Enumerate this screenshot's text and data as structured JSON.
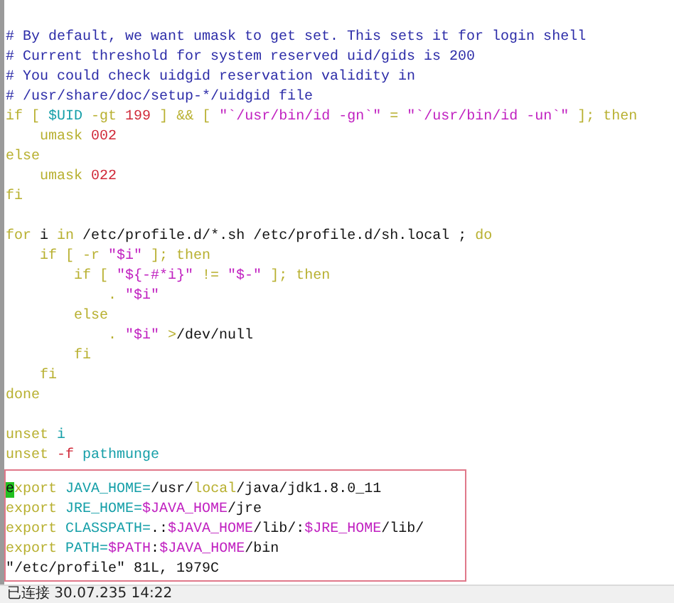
{
  "editor": {
    "lines": [
      {
        "kind": "blank"
      },
      {
        "kind": "code",
        "segments": [
          {
            "kind": "comment",
            "text": "# By default, we want umask to get set. This sets it for login shell"
          }
        ]
      },
      {
        "kind": "code",
        "segments": [
          {
            "kind": "comment",
            "text": "# Current threshold for system reserved uid/gids is 200"
          }
        ]
      },
      {
        "kind": "code",
        "segments": [
          {
            "kind": "comment",
            "text": "# You could check uidgid reservation validity in"
          }
        ]
      },
      {
        "kind": "code",
        "segments": [
          {
            "kind": "comment",
            "text": "# /usr/share/doc/setup-*/uidgid file"
          }
        ]
      },
      {
        "kind": "code",
        "segments": [
          {
            "kind": "kw",
            "text": "if [ "
          },
          {
            "kind": "var",
            "text": "$UID"
          },
          {
            "kind": "kw",
            "text": " -gt "
          },
          {
            "kind": "num",
            "text": "199"
          },
          {
            "kind": "kw",
            "text": " ] && [ "
          },
          {
            "kind": "str",
            "text": "\"`/usr/bin/id -gn`\""
          },
          {
            "kind": "kw",
            "text": " = "
          },
          {
            "kind": "str",
            "text": "\"`/usr/bin/id -un`\""
          },
          {
            "kind": "kw",
            "text": " ]; then"
          }
        ]
      },
      {
        "kind": "code",
        "segments": [
          {
            "kind": "kw",
            "text": "    umask "
          },
          {
            "kind": "num",
            "text": "002"
          }
        ]
      },
      {
        "kind": "code",
        "segments": [
          {
            "kind": "kw",
            "text": "else"
          }
        ]
      },
      {
        "kind": "code",
        "segments": [
          {
            "kind": "kw",
            "text": "    umask "
          },
          {
            "kind": "num",
            "text": "022"
          }
        ]
      },
      {
        "kind": "code",
        "segments": [
          {
            "kind": "kw",
            "text": "fi"
          }
        ]
      },
      {
        "kind": "blank"
      },
      {
        "kind": "code",
        "segments": [
          {
            "kind": "kw",
            "text": "for"
          },
          {
            "kind": "plain",
            "text": " i "
          },
          {
            "kind": "kw",
            "text": "in"
          },
          {
            "kind": "plain",
            "text": " /etc/profile.d/*.sh /etc/profile.d/sh.local ; "
          },
          {
            "kind": "kw",
            "text": "do"
          }
        ]
      },
      {
        "kind": "code",
        "segments": [
          {
            "kind": "kw",
            "text": "    if [ -r "
          },
          {
            "kind": "str",
            "text": "\"$i\""
          },
          {
            "kind": "kw",
            "text": " ]; then"
          }
        ]
      },
      {
        "kind": "code",
        "segments": [
          {
            "kind": "kw",
            "text": "        if [ "
          },
          {
            "kind": "str",
            "text": "\"${-#*i}\""
          },
          {
            "kind": "kw",
            "text": " != "
          },
          {
            "kind": "str",
            "text": "\"$-\""
          },
          {
            "kind": "kw",
            "text": " ]; then"
          }
        ]
      },
      {
        "kind": "code",
        "segments": [
          {
            "kind": "kw",
            "text": "            . "
          },
          {
            "kind": "str",
            "text": "\"$i\""
          }
        ]
      },
      {
        "kind": "code",
        "segments": [
          {
            "kind": "kw",
            "text": "        else"
          }
        ]
      },
      {
        "kind": "code",
        "segments": [
          {
            "kind": "kw",
            "text": "            . "
          },
          {
            "kind": "str",
            "text": "\"$i\""
          },
          {
            "kind": "kw",
            "text": " >"
          },
          {
            "kind": "plain",
            "text": "/dev/null"
          }
        ]
      },
      {
        "kind": "code",
        "segments": [
          {
            "kind": "kw",
            "text": "        fi"
          }
        ]
      },
      {
        "kind": "code",
        "segments": [
          {
            "kind": "kw",
            "text": "    fi"
          }
        ]
      },
      {
        "kind": "code",
        "segments": [
          {
            "kind": "kw",
            "text": "done"
          }
        ]
      },
      {
        "kind": "blank"
      },
      {
        "kind": "code",
        "segments": [
          {
            "kind": "kw",
            "text": "unset "
          },
          {
            "kind": "var",
            "text": "i"
          }
        ]
      },
      {
        "kind": "code",
        "segments": [
          {
            "kind": "kw",
            "text": "unset "
          },
          {
            "kind": "num",
            "text": "-f "
          },
          {
            "kind": "var",
            "text": "pathmunge"
          }
        ]
      }
    ],
    "boxed_lines": [
      {
        "kind": "code",
        "segments": [
          {
            "kind": "cursor",
            "text": "e"
          },
          {
            "kind": "kw",
            "text": "xport "
          },
          {
            "kind": "var",
            "text": "JAVA_HOME="
          },
          {
            "kind": "plain",
            "text": "/usr/"
          },
          {
            "kind": "kw",
            "text": "local"
          },
          {
            "kind": "plain",
            "text": "/java/jdk1.8.0_11"
          }
        ]
      },
      {
        "kind": "code",
        "segments": [
          {
            "kind": "kw",
            "text": "export "
          },
          {
            "kind": "var",
            "text": "JRE_HOME="
          },
          {
            "kind": "str",
            "text": "$JAVA_HOME"
          },
          {
            "kind": "plain",
            "text": "/jre"
          }
        ]
      },
      {
        "kind": "code",
        "segments": [
          {
            "kind": "kw",
            "text": "export "
          },
          {
            "kind": "var",
            "text": "CLASSPATH="
          },
          {
            "kind": "plain",
            "text": ".:"
          },
          {
            "kind": "str",
            "text": "$JAVA_HOME"
          },
          {
            "kind": "plain",
            "text": "/lib/:"
          },
          {
            "kind": "str",
            "text": "$JRE_HOME"
          },
          {
            "kind": "plain",
            "text": "/lib/"
          }
        ]
      },
      {
        "kind": "code",
        "segments": [
          {
            "kind": "kw",
            "text": "export "
          },
          {
            "kind": "var",
            "text": "PATH="
          },
          {
            "kind": "str",
            "text": "$PATH"
          },
          {
            "kind": "plain",
            "text": ":"
          },
          {
            "kind": "str",
            "text": "$JAVA_HOME"
          },
          {
            "kind": "plain",
            "text": "/bin"
          }
        ]
      }
    ],
    "message": "\"/etc/profile\" 81L, 1979C"
  },
  "status_bar": {
    "text": "已连接 30.07.235 14:22"
  }
}
